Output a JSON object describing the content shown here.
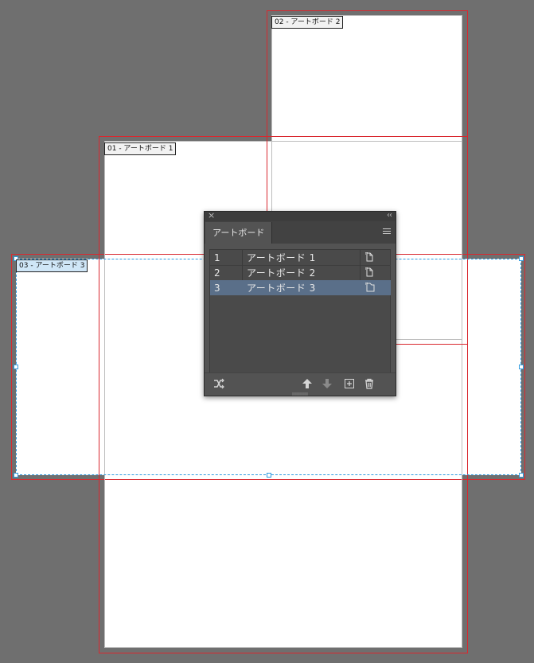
{
  "canvas": {
    "artboards": [
      {
        "label": "01 - アートボード 1"
      },
      {
        "label": "02 - アートボード 2"
      },
      {
        "label": "03 - アートボード 3"
      }
    ]
  },
  "panel": {
    "tab_label": "アートボード",
    "close_icon": "close-icon",
    "collapse_icon": "collapse-icon",
    "menu_icon": "panel-menu-icon",
    "rows": [
      {
        "num": "1",
        "name": "アートボード 1",
        "selected": false
      },
      {
        "num": "2",
        "name": "アートボード 2",
        "selected": false
      },
      {
        "num": "3",
        "name": "アートボード 3",
        "selected": true
      }
    ],
    "footer_icons": [
      "rearrange-icon",
      "move-up-icon",
      "move-down-icon",
      "new-artboard-icon",
      "delete-icon"
    ]
  },
  "colors": {
    "pasteboard": "#6f6f6f",
    "bleed": "#d9282f",
    "selection": "#2f9be0",
    "panel_bg": "#535353",
    "selected_row": "#5a6f89"
  }
}
